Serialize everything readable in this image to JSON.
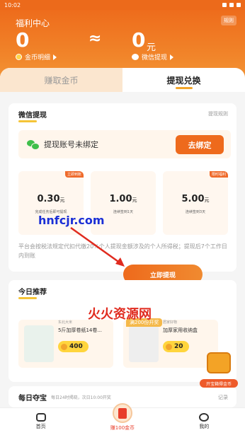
{
  "status_bar": {
    "time": "10:02"
  },
  "header": {
    "title": "福利中心",
    "rules_label": "规则",
    "coins_value": "0",
    "approx_symbol": "≈",
    "cash_value": "0",
    "cash_unit": "元",
    "coin_detail_link": "金币明细",
    "wechat_withdraw_link": "微信提现"
  },
  "tabs": [
    {
      "label": "赚取金币",
      "active": false
    },
    {
      "label": "提现兑换",
      "active": true
    }
  ],
  "withdraw_card": {
    "title": "微信提现",
    "more_link": "提现规则",
    "bind_status_text": "提现账号未绑定",
    "bind_button": "去绑定",
    "amounts": [
      {
        "badge": "立即到账",
        "value": "0.30",
        "unit": "元",
        "desc": "完成任务后即可提现"
      },
      {
        "badge": "",
        "value": "1.00",
        "unit": "元",
        "desc": "连续签到1天"
      },
      {
        "badge": "限时福利",
        "value": "5.00",
        "unit": "元",
        "desc": "连续签到3天"
      }
    ],
    "notice": "平台会按税法规定代扣代缴20%个人提现金额涉及的个人所得税；提现后7个工作日内到账",
    "withdraw_button": "立即提现"
  },
  "recommend_card": {
    "title": "今日推荐",
    "items": [
      {
        "sub": "东北大米",
        "name": "5斤加厚卷纸14卷...",
        "price": "400"
      },
      {
        "sub": "居家好物",
        "name": "加厚家用收纳盒",
        "price": "20"
      }
    ],
    "tag": "满200份开奖"
  },
  "treasure": {
    "label": "开宝箱得金币"
  },
  "daily_card": {
    "title": "每日夺宝",
    "sub": "每日24时揭晓，次日10:00开奖",
    "more": "记录"
  },
  "watermarks": {
    "site": "hnfcjr.com",
    "brand": "火火资源网"
  },
  "bottom_nav": [
    {
      "label": "首页"
    },
    {
      "label": "赚100金币"
    },
    {
      "label": "我的"
    }
  ]
}
